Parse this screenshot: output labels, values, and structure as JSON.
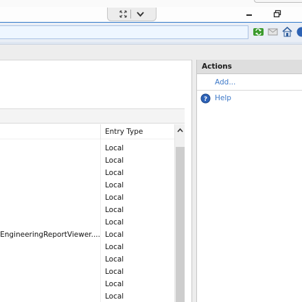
{
  "window": {
    "icons": {
      "fullscreen": "fullscreen-icon",
      "chevron": "chevron-down-icon",
      "minimize": "minimize-icon",
      "restore": "restore-icon"
    }
  },
  "toolbar": {
    "icons": [
      "refresh-icon",
      "mail-icon",
      "home-icon",
      "help-icon"
    ]
  },
  "list": {
    "columns": {
      "entry_type": "Entry Type"
    },
    "rows": [
      {
        "path": "",
        "entry_type": "Local"
      },
      {
        "path": "",
        "entry_type": "Local"
      },
      {
        "path": "",
        "entry_type": "Local"
      },
      {
        "path": "",
        "entry_type": "Local"
      },
      {
        "path": "",
        "entry_type": "Local"
      },
      {
        "path": "",
        "entry_type": "Local"
      },
      {
        "path": "",
        "entry_type": "Local"
      },
      {
        "path": "/EngineeringReportViewer....",
        "entry_type": "Local"
      },
      {
        "path": "",
        "entry_type": "Local"
      },
      {
        "path": "",
        "entry_type": "Local"
      },
      {
        "path": "",
        "entry_type": "Local"
      },
      {
        "path": "",
        "entry_type": "Local"
      },
      {
        "path": "",
        "entry_type": "Local"
      }
    ]
  },
  "actions": {
    "title": "Actions",
    "add_label": "Add...",
    "help_label": "Help"
  },
  "colors": {
    "link": "#3c78c8",
    "address_bg": "#eef6ff",
    "panel_header": "#dedede"
  }
}
